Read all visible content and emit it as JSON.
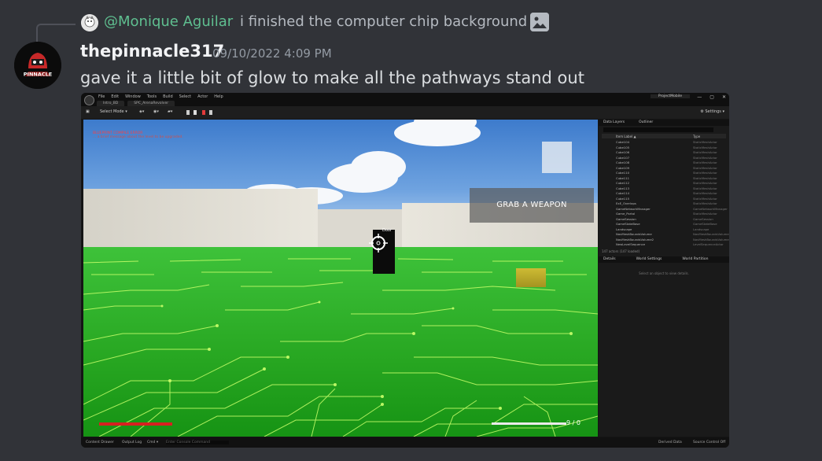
{
  "reply": {
    "author": "@Monique Aguilar",
    "text": "i finished the computer chip background",
    "attachment_icon": "image-icon"
  },
  "message": {
    "username": "thepinnacle317",
    "timestamp": "09/10/2022 4:09 PM",
    "text": "gave it a little bit of glow to make all the pathways stand out",
    "avatar_text": "PINNACLE"
  },
  "colors": {
    "background": "#313338",
    "reply_author": "#5fbf90",
    "username": "#f2f3f5",
    "floor_green": "#2fb42a",
    "circuit": "#c8ff6a"
  },
  "editor": {
    "menu": [
      "File",
      "Edit",
      "Window",
      "Tools",
      "Build",
      "Select",
      "Actor",
      "Help"
    ],
    "tabs": [
      "Intro_BD",
      "SPC_ArenaRevolver"
    ],
    "project": "ProjectMobile",
    "window_buttons": [
      "—",
      "▢",
      "✕"
    ],
    "toolbar": {
      "select_mode": "Select Mode ▾",
      "settings": "⚙ Settings ▾"
    },
    "viewport": {
      "debug_line1": "BLUEPRINT COMPILE ERROR",
      "debug_line2": "... a brief message about the level to be upgraded.",
      "grab_prompt": "GRAB A WEAPON",
      "pillar_label": "Door",
      "ammo": "9 / 0"
    },
    "outliner": {
      "tabs": [
        "Data Layers",
        "Outliner"
      ],
      "columns": [
        "Item Label ▲",
        "Type"
      ],
      "rows": [
        {
          "label": "Cube104",
          "type": "StaticMeshActor"
        },
        {
          "label": "Cube105",
          "type": "StaticMeshActor"
        },
        {
          "label": "Cube106",
          "type": "StaticMeshActor"
        },
        {
          "label": "Cube107",
          "type": "StaticMeshActor"
        },
        {
          "label": "Cube108",
          "type": "StaticMeshActor"
        },
        {
          "label": "Cube109",
          "type": "StaticMeshActor"
        },
        {
          "label": "Cube110",
          "type": "StaticMeshActor"
        },
        {
          "label": "Cube111",
          "type": "StaticMeshActor"
        },
        {
          "label": "Cube112",
          "type": "StaticMeshActor"
        },
        {
          "label": "Cube113",
          "type": "StaticMeshActor"
        },
        {
          "label": "Cube114",
          "type": "StaticMeshActor"
        },
        {
          "label": "Cube115",
          "type": "StaticMeshActor"
        },
        {
          "label": "ExE_Overlaps",
          "type": "StaticMeshActor"
        },
        {
          "label": "GameNetworkManager",
          "type": "GameNetworkManager"
        },
        {
          "label": "Game_Portal",
          "type": "StaticMeshActor"
        },
        {
          "label": "GameSession",
          "type": "GameSession"
        },
        {
          "label": "GameStateBase",
          "type": "GameStateBase"
        },
        {
          "label": "Landscape",
          "type": "Landscape"
        },
        {
          "label": "NavMeshBoundsVolume",
          "type": "NavMeshBoundsVolume"
        },
        {
          "label": "NavMeshBoundsVolume2",
          "type": "NavMeshBoundsVolume"
        },
        {
          "label": "NewLevelSequence",
          "type": "LevelSequenceActor"
        }
      ],
      "count": "147 actors (147 loaded)",
      "details_tabs": [
        "Details",
        "World Settings",
        "World Partition"
      ],
      "details_empty": "Select an object to view details."
    },
    "statusbar": {
      "content_drawer": "Content Drawer",
      "output_log": "Output Log",
      "cmd": "Cmd ▾",
      "cmd_placeholder": "Enter Console Command",
      "derived_data": "Derived Data",
      "source_control": "Source Control Off"
    }
  }
}
